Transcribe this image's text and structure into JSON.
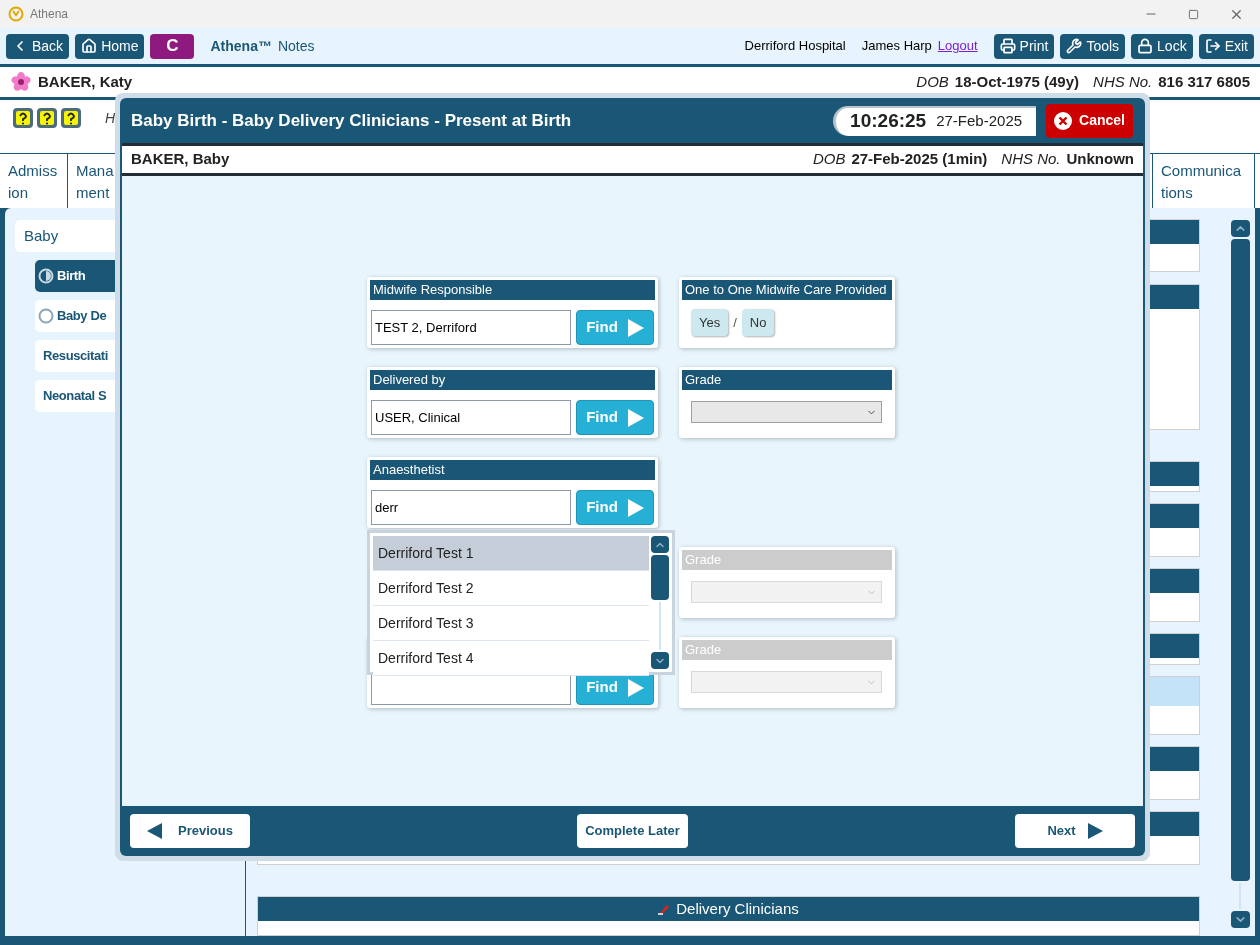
{
  "window": {
    "title": "Athena"
  },
  "toolbar": {
    "left": [
      {
        "kind": "back",
        "label": "Back"
      },
      {
        "kind": "home",
        "label": "Home"
      },
      {
        "kind": "letter",
        "label": "C"
      }
    ],
    "app_name": "Athena™",
    "app_suffix": "Notes",
    "hospital": "Derriford Hospital",
    "user": "James Harp",
    "logout": "Logout",
    "right": [
      {
        "kind": "print",
        "label": "Print"
      },
      {
        "kind": "tools",
        "label": "Tools"
      },
      {
        "kind": "lock",
        "label": "Lock"
      },
      {
        "kind": "exit",
        "label": "Exit"
      }
    ]
  },
  "patient": {
    "name": "BAKER, Katy",
    "dob_label": "DOB",
    "dob": "18-Oct-1975 (49y)",
    "nhs_label": "NHS No.",
    "nhs": "816 317 6805"
  },
  "info_row": {
    "text": "H"
  },
  "tabs": [
    {
      "lines": [
        "Admiss",
        "ion"
      ]
    },
    {
      "lines": [
        "Mana",
        "ment"
      ]
    },
    {
      "lines": [
        "Communica",
        "tions"
      ]
    }
  ],
  "sidebar": {
    "heading": "Baby",
    "items": [
      {
        "label": "Birth",
        "selected": true,
        "kind": "half"
      },
      {
        "label": "Baby De",
        "selected": false,
        "kind": "empty"
      },
      {
        "label": "Resuscitati",
        "selected": false,
        "kind": "plain"
      },
      {
        "label": "Neonatal S",
        "selected": false,
        "kind": "plain"
      }
    ]
  },
  "sections": [
    {
      "highlighted": false
    },
    {
      "highlighted": false
    },
    {
      "highlighted": false
    },
    {
      "highlighted": false
    },
    {
      "highlighted": false
    },
    {
      "highlighted": false
    },
    {
      "highlighted": true
    },
    {
      "highlighted": false
    },
    {
      "highlighted": false
    },
    {
      "highlighted": false,
      "title": "Delivery Clinicians"
    }
  ],
  "modal": {
    "title": "Baby Birth - Baby Delivery Clinicians - Present at Birth",
    "time": "10:26:25",
    "date": "27-Feb-2025",
    "cancel": "Cancel",
    "baby": {
      "name": "BAKER, Baby",
      "dob_label": "DOB",
      "dob": "27-Feb-2025 (1min)",
      "nhs_label": "NHS No.",
      "nhs": "Unknown"
    },
    "rows": [
      {
        "left": {
          "kind": "finder",
          "label": "Midwife Responsible",
          "value": "TEST 2, Derriford",
          "button": "Find"
        },
        "right": {
          "kind": "choice",
          "label": "One to One Midwife Care Provided",
          "options": [
            {
              "label": "Yes",
              "selected": false
            },
            {
              "label": "No",
              "selected": false
            }
          ],
          "separator": "/"
        }
      },
      {
        "left": {
          "kind": "finder",
          "label": "Delivered by",
          "value": "USER, Clinical",
          "button": "Find"
        },
        "right": {
          "kind": "select",
          "label": "Grade",
          "disabled": false
        }
      },
      {
        "left": {
          "kind": "finder",
          "label": "Anaesthetist",
          "value": "derr",
          "button": "Find"
        }
      },
      {
        "right": {
          "kind": "select",
          "label": "Grade",
          "disabled": true
        }
      },
      {
        "left": {
          "kind": "finder",
          "button": "Find"
        },
        "right": {
          "kind": "select",
          "label": "Grade",
          "disabled": true
        }
      }
    ],
    "suggestions": [
      {
        "label": "Derriford Test 1",
        "selected": true
      },
      {
        "label": "Derriford Test 2",
        "selected": false
      },
      {
        "label": "Derriford Test 3",
        "selected": false
      },
      {
        "label": "Derriford Test 4",
        "selected": false
      }
    ],
    "footer": {
      "previous": "Previous",
      "later": "Complete Later",
      "next": "Next"
    }
  }
}
